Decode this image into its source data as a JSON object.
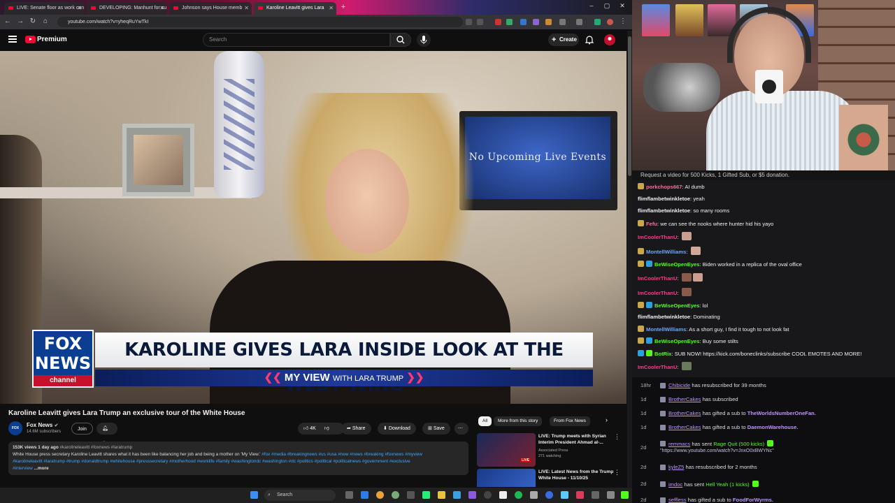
{
  "browser": {
    "tabs": [
      {
        "title": "LIVE: Senate floor as work con"
      },
      {
        "title": "DEVELOPING: Manhunt for su"
      },
      {
        "title": "Johnson says House memb"
      },
      {
        "title": "Karoline Leavitt gives Lara"
      }
    ],
    "url": "youtube.com/watch?v=yheqRuYwTkI"
  },
  "youtube": {
    "brand": "Premium",
    "search_placeholder": "Search",
    "create_label": "Create"
  },
  "video": {
    "tv_text": "No Upcoming Live Events",
    "lower_third": {
      "logo_top": "FOX NEWS",
      "logo_bottom": "channel",
      "headline": "KAROLINE GIVES LARA INSIDE LOOK AT THE WEST WING",
      "subbar_main": "MY VIEW",
      "subbar_with": "WITH LARA TRUMP"
    },
    "title": "Karoline Leavitt gives Lara Trump an exclusive tour of the White House",
    "channel": {
      "name": "Fox News",
      "subscribers": "14.6M subscribers",
      "avatar_text": "FOX"
    },
    "actions": {
      "join": "Join",
      "likes": "4K",
      "share": "Share",
      "download": "Download",
      "save": "Save"
    },
    "description": {
      "meta": "153K views  1 day ago",
      "meta_tags": "#karolineleavitt #foxnews #laratrump",
      "text": "White House press secretary Karoline Leavitt shares what it has been like balancing her job and being a mother on 'My View.'",
      "tags1": "#fox #media #breakingnews #us #usa #new #news #breaking #foxnews #myview",
      "tags2": "#karolineleavitt #laratrump #trump #donaldtrump #whitehouse #presssecretary #motherhood #worklife #family #washingtondc #washington #dc #politics #political #politicalnews #government #exclusive",
      "tags3": "#interview",
      "more": "...more"
    }
  },
  "recommended": {
    "chips": [
      "All",
      "More from this story",
      "From Fox News"
    ],
    "items": [
      {
        "title": "LIVE: Trump meets with Syrian Interim President Ahmad al-...",
        "channel": "Associated Press",
        "meta": "271 watching",
        "badge": "LIVE"
      },
      {
        "title": "LIVE: Latest News from the Trump White House - 11/10/25",
        "channel": "",
        "meta": ""
      }
    ]
  },
  "taskbar": {
    "search": "Search"
  },
  "stream": {
    "request_banner": "Request a video for 500 Kicks, 1 Gifted Sub, or $5 donation.",
    "chat": [
      {
        "user": "porkchops667",
        "text": "AI dumb",
        "color": "#ff6b9a"
      },
      {
        "user": "flimflambetwinkletoe",
        "text": "yeah",
        "color": "#efeff1"
      },
      {
        "user": "flimflambetwinkletoe",
        "text": "so many rooms",
        "color": "#efeff1"
      },
      {
        "user": "Fefu",
        "text": "we can see the nooks where hunter hid his yayo",
        "color": "#ff6b9a"
      },
      {
        "user": "ImCoolerThanU",
        "text": "",
        "color": "#ff3a8a"
      },
      {
        "user": "MontellWilliams",
        "text": "",
        "color": "#6aa8ff"
      },
      {
        "user": "BeWiseOpenEyes",
        "text": "Biden worked in a replica of the oval office",
        "color": "#53fc18"
      },
      {
        "user": "ImCoolerThanU",
        "text": "",
        "color": "#ff3a8a"
      },
      {
        "user": "ImCoolerThanU",
        "text": "",
        "color": "#ff3a8a"
      },
      {
        "user": "BeWiseOpenEyes",
        "text": "lol",
        "color": "#53fc18"
      },
      {
        "user": "flimflambetwinkletoe",
        "text": "Dominating",
        "color": "#efeff1"
      },
      {
        "user": "MontellWilliams",
        "text": "As a short guy, I find it tough to not look fat",
        "color": "#6aa8ff"
      },
      {
        "user": "BeWiseOpenEyes",
        "text": "Buy some stilts",
        "color": "#53fc18"
      },
      {
        "user": "BotRix",
        "text": "SUB NOW! https://kick.com/boneclinks/subscribe COOL EMOTES AND MORE!",
        "color": "#53fc18"
      },
      {
        "user": "ImCoolerThanU",
        "text": "",
        "color": "#ff3a8a"
      }
    ],
    "events": [
      {
        "age": "18hr",
        "name": "Chibicide",
        "text": "has resubscribed for 39 months",
        "extra": ""
      },
      {
        "age": "1d",
        "name": "BrotherCakes",
        "text": "has subscribed",
        "extra": ""
      },
      {
        "age": "1d",
        "name": "BrotherCakes",
        "text": "has gifted a sub to",
        "extra": "TheWorldsNumberOneFan."
      },
      {
        "age": "1d",
        "name": "BrotherCakes",
        "text": "has gifted a sub to",
        "extra": "DaemonWarehouse."
      },
      {
        "age": "2d",
        "name": "remmacs",
        "text": "has sent",
        "extra": "Rage Quit (500 kicks)",
        "url": "\"https://www.youtube.com/watch?v=JnxO0xBWYNc\""
      },
      {
        "age": "2d",
        "name": "kyleZ5",
        "text": "has resubscribed for 2 months",
        "extra": ""
      },
      {
        "age": "2d",
        "name": "imdoc",
        "text": "has sent",
        "extra": "Hell Yeah (1 kicks)"
      },
      {
        "age": "2d",
        "name": "seffless",
        "text": "has gifted a sub to",
        "extra": "FoodForWyrms."
      }
    ]
  }
}
